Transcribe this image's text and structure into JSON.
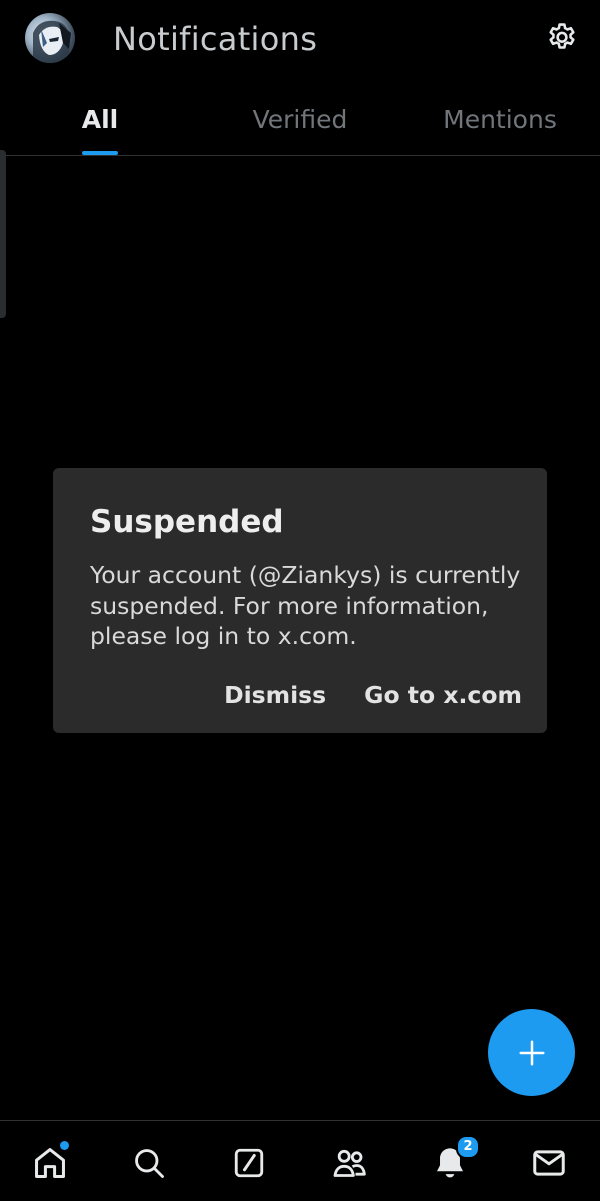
{
  "header": {
    "title": "Notifications",
    "avatar_icon": "user-avatar",
    "settings_icon": "gear-icon"
  },
  "tabs": [
    {
      "label": "All",
      "active": true
    },
    {
      "label": "Verified",
      "active": false
    },
    {
      "label": "Mentions",
      "active": false
    }
  ],
  "dialog": {
    "title": "Suspended",
    "message": "Your account (@Ziankys) is currently suspended. For more information, please log in to x.com.",
    "dismiss_label": "Dismiss",
    "primary_label": "Go to x.com"
  },
  "fab": {
    "icon": "plus-icon"
  },
  "bottom_nav": {
    "items": [
      {
        "name": "home",
        "icon": "home-icon",
        "has_dot": true
      },
      {
        "name": "search",
        "icon": "search-icon"
      },
      {
        "name": "grok",
        "icon": "grok-icon"
      },
      {
        "name": "communities",
        "icon": "people-icon"
      },
      {
        "name": "notifications",
        "icon": "bell-icon",
        "badge": "2"
      },
      {
        "name": "messages",
        "icon": "mail-icon"
      }
    ]
  },
  "colors": {
    "background": "#000000",
    "accent": "#1d9bf0",
    "dialog_background": "#2b2b2b",
    "muted_text": "#71767b"
  }
}
